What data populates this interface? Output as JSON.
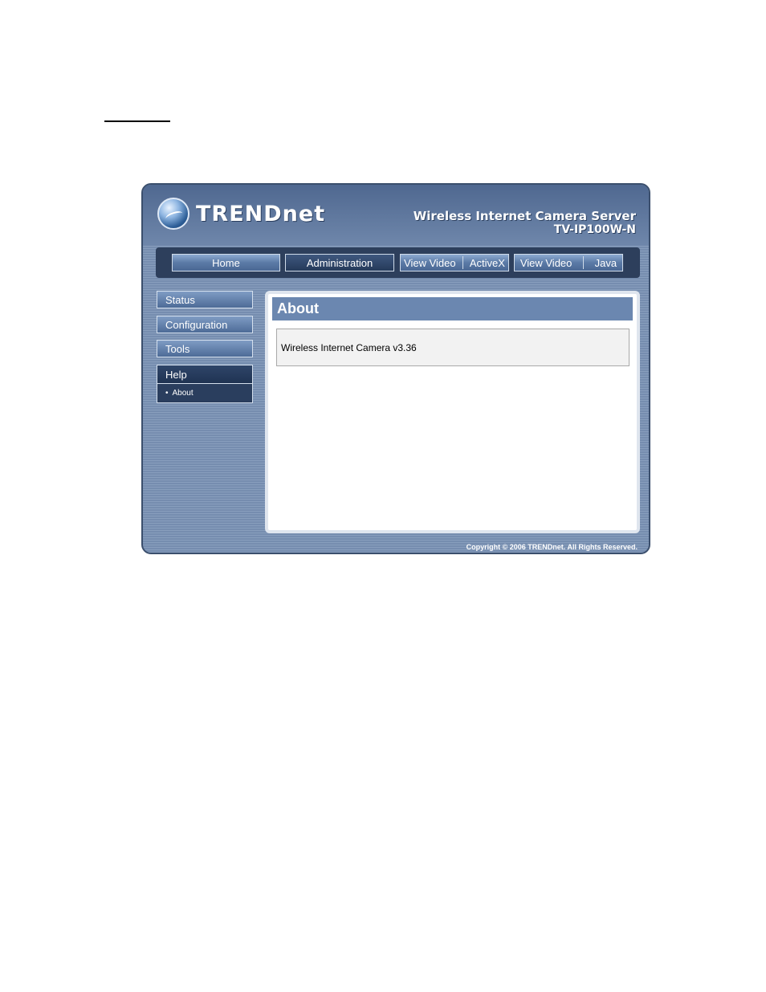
{
  "header": {
    "brand": "TRENDnet",
    "product_title": "Wireless Internet Camera Server",
    "model": "TV-IP100W-N"
  },
  "nav": {
    "home": "Home",
    "administration": "Administration",
    "view_video_activex_left": "View Video",
    "view_video_activex_right": "ActiveX",
    "view_video_java_left": "View Video",
    "view_video_java_right": "Java"
  },
  "sidebar": {
    "items": [
      {
        "label": "Status"
      },
      {
        "label": "Configuration"
      },
      {
        "label": "Tools"
      },
      {
        "label": "Help"
      }
    ],
    "sub_items": [
      {
        "label": "About"
      }
    ]
  },
  "main": {
    "title": "About",
    "version_text": "Wireless Internet Camera v3.36"
  },
  "footer": {
    "copyright": "Copyright © 2006 TRENDnet. All Rights Reserved."
  },
  "colors": {
    "frame_bg": "#7b93b6",
    "nav_bg": "#2d3f5c",
    "panel_title_bg": "#6b87b0"
  }
}
